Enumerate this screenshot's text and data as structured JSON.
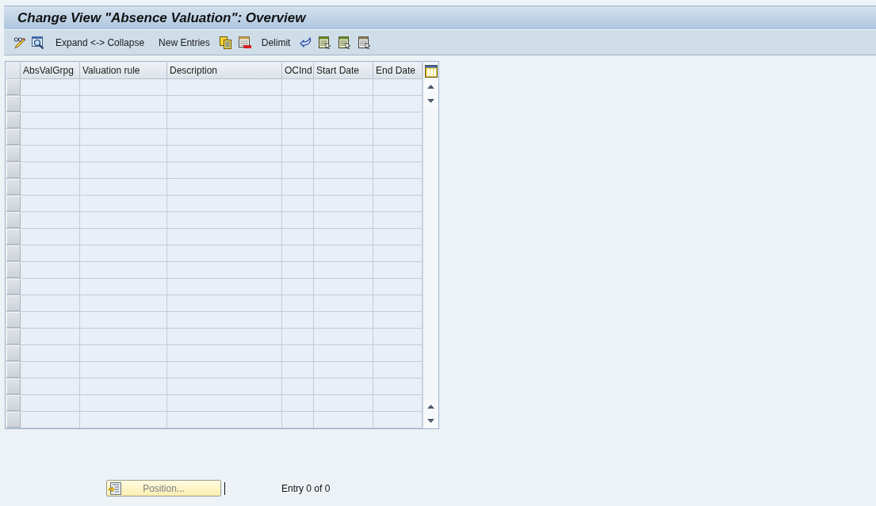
{
  "window": {
    "title": "Change View \"Absence Valuation\": Overview"
  },
  "toolbar": {
    "buttons": [
      "Expand <-> Collapse",
      "New Entries",
      "Delimit"
    ]
  },
  "table": {
    "columns": [
      "AbsValGrpg",
      "Valuation rule",
      "Description",
      "OCInd",
      "Start Date",
      "End Date"
    ]
  },
  "footer": {
    "position_button": "Position...",
    "entry_counter": "Entry 0 of 0"
  }
}
